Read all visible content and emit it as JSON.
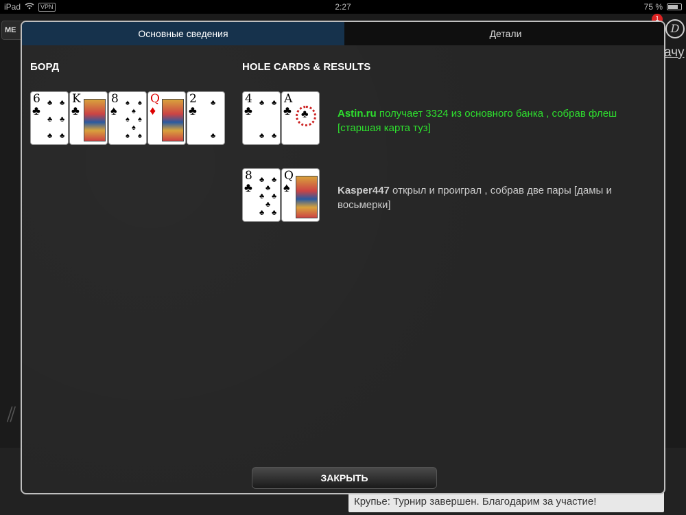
{
  "statusbar": {
    "device": "iPad",
    "vpn": "VPN",
    "time": "2:27",
    "battery": "75 %"
  },
  "background": {
    "menu": "МЕ",
    "logo": "D",
    "badge": "1",
    "link": "ачу",
    "chat": "Крупье: Турнир завершен. Благодарим за участие!"
  },
  "tabs": [
    {
      "label": "Основные сведения",
      "active": true
    },
    {
      "label": "Детали",
      "active": false
    }
  ],
  "board": {
    "title": "БОРД",
    "cards": [
      {
        "rank": "6",
        "suit": "♣",
        "color": "black"
      },
      {
        "rank": "K",
        "suit": "♣",
        "color": "black"
      },
      {
        "rank": "8",
        "suit": "♠",
        "color": "black"
      },
      {
        "rank": "Q",
        "suit": "♦",
        "color": "red"
      },
      {
        "rank": "2",
        "suit": "♣",
        "color": "black"
      }
    ]
  },
  "results": {
    "title": "HOLE CARDS & RESULTS",
    "players": [
      {
        "cards": [
          {
            "rank": "4",
            "suit": "♣"
          },
          {
            "rank": "A",
            "suit": "♣"
          }
        ],
        "name": "Astin.ru",
        "text": " получает 3324 из основного банка , собрав флеш [старшая карта туз]",
        "color": "#2ee02e"
      },
      {
        "cards": [
          {
            "rank": "8",
            "suit": "♣"
          },
          {
            "rank": "Q",
            "suit": "♠"
          }
        ],
        "name": "Kasper447",
        "text": " открыл и проиграл , собрав две пары [дамы и восьмерки]",
        "color": "#cccccc"
      }
    ]
  },
  "close_label": "ЗАКРЫТЬ"
}
